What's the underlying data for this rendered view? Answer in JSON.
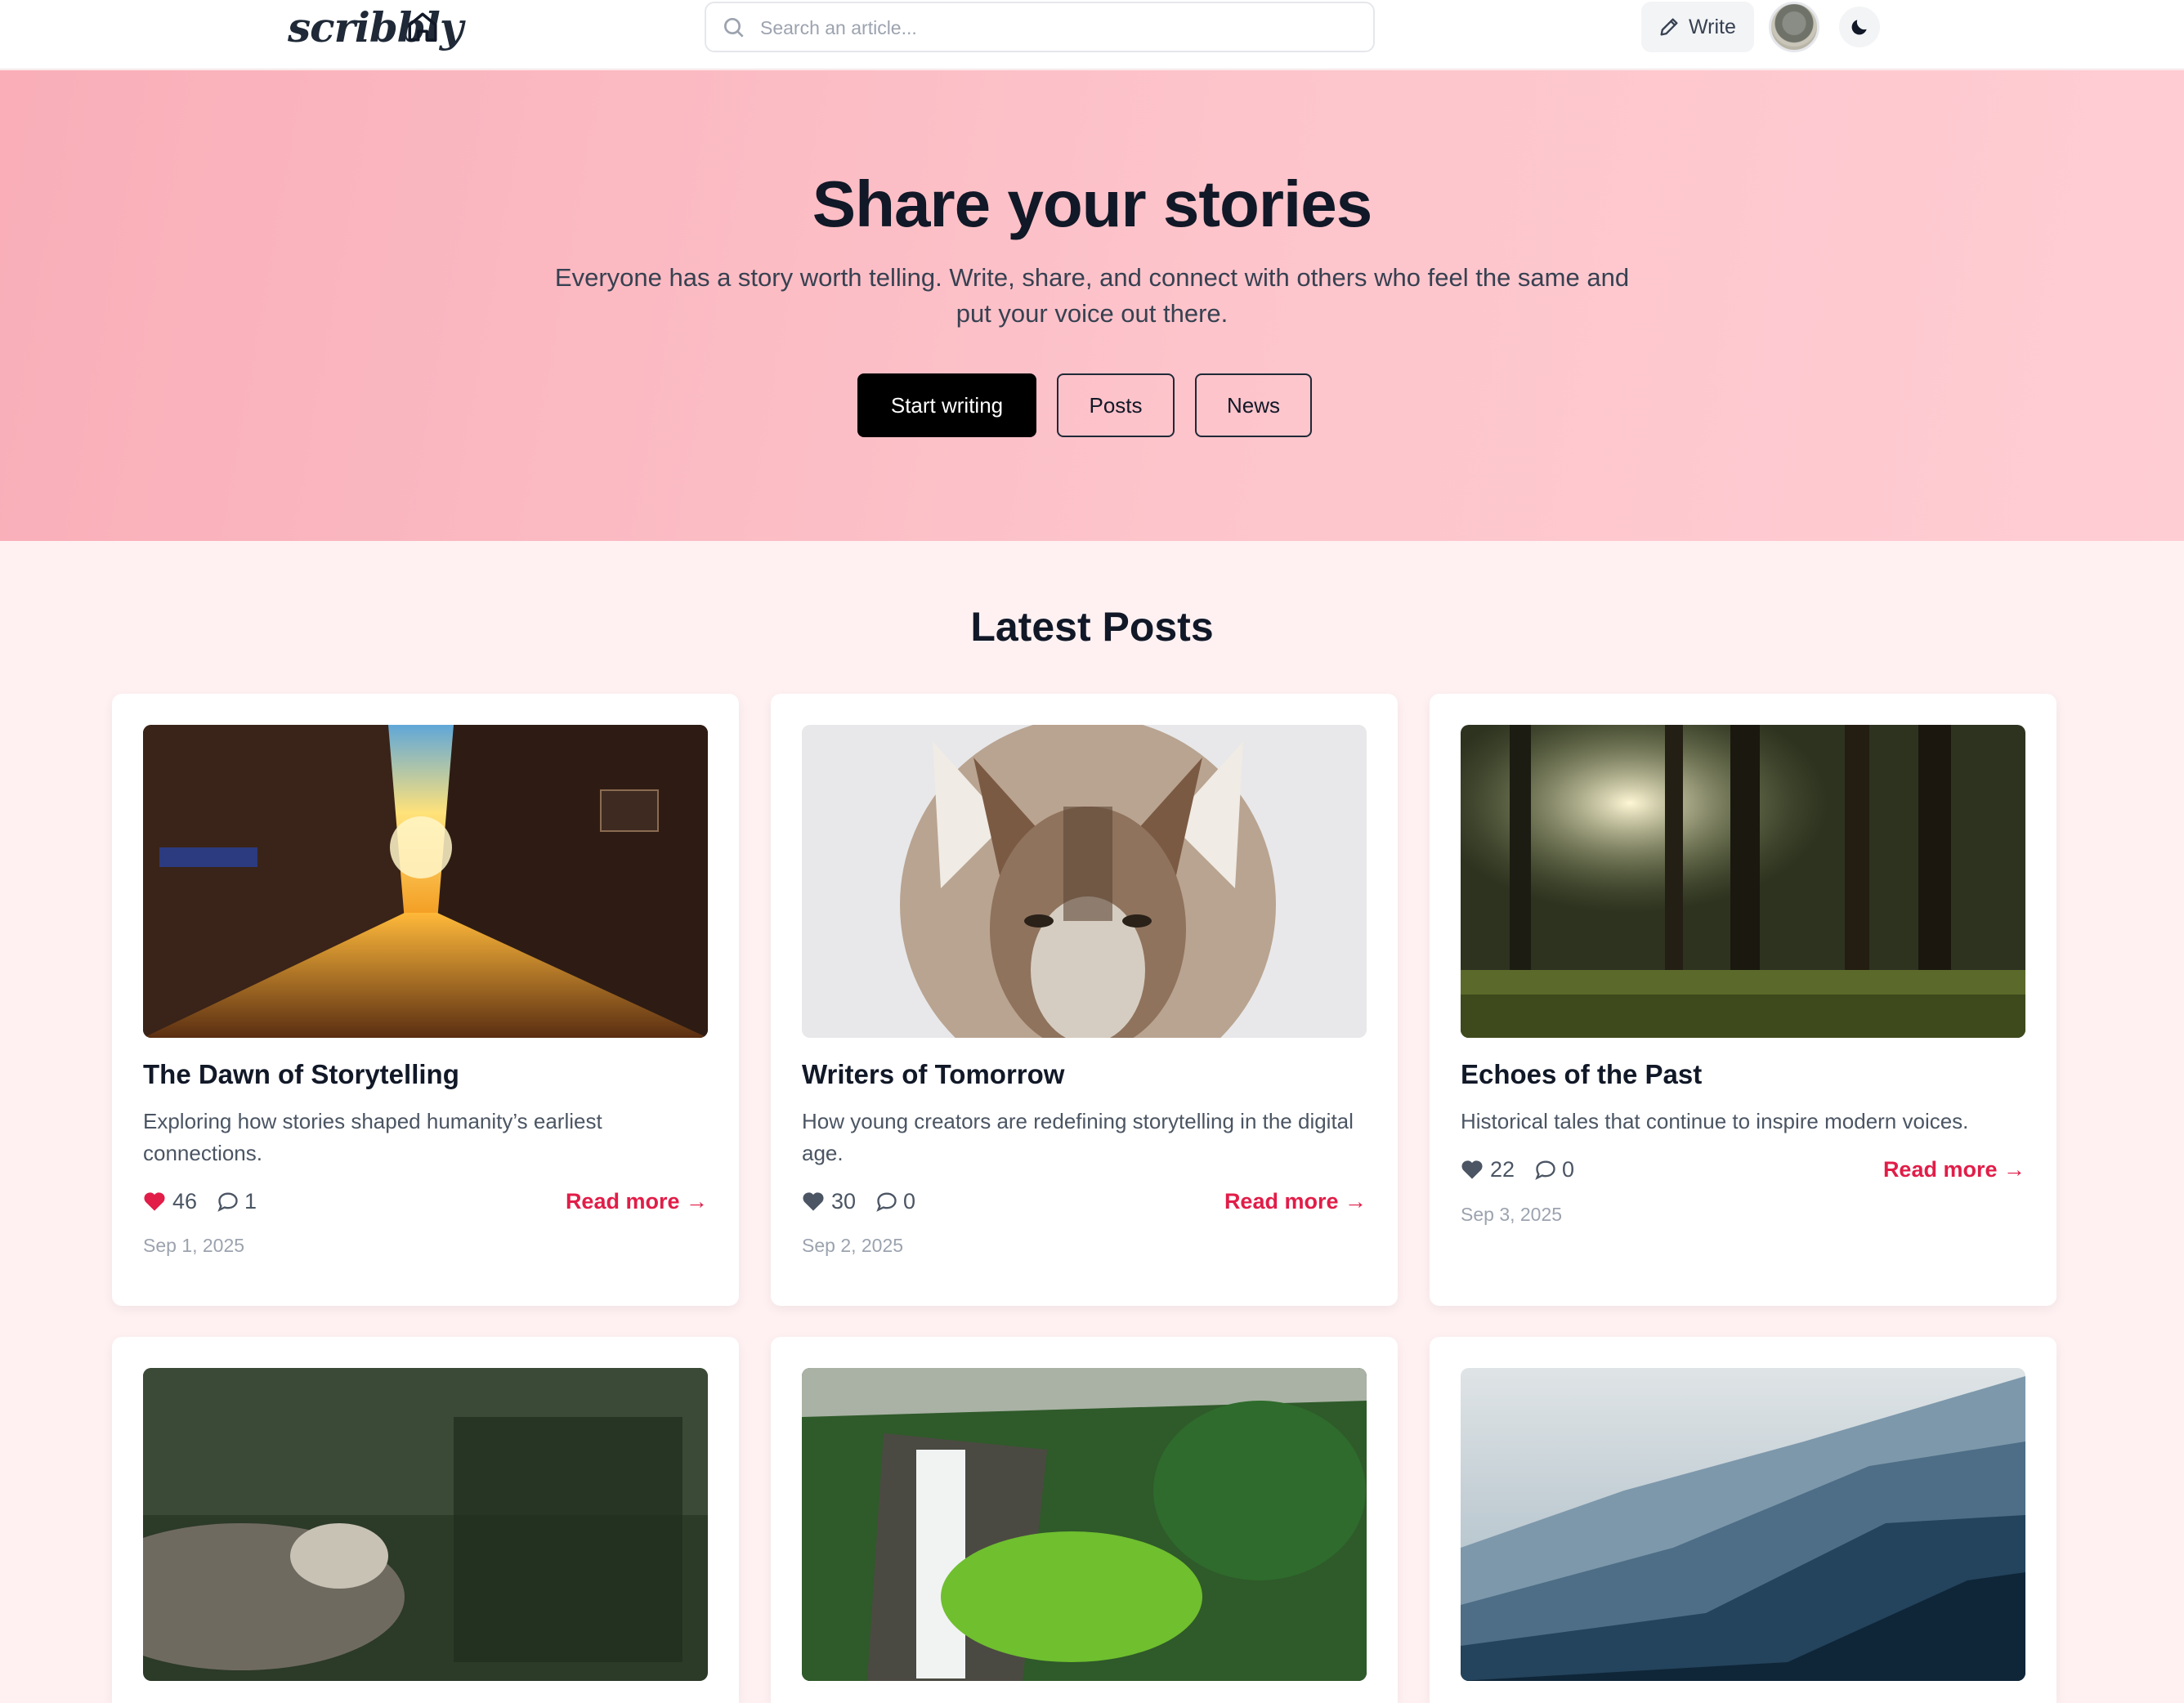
{
  "header": {
    "logo": "scribbly",
    "search_placeholder": "Search an article...",
    "write_label": "Write"
  },
  "hero": {
    "title": "Share your stories",
    "subtitle": "Everyone has a story worth telling. Write, share, and connect with others who feel the same and put your voice out there.",
    "buttons": {
      "start": "Start writing",
      "posts": "Posts",
      "news": "News"
    }
  },
  "latest": {
    "title": "Latest Posts",
    "cards": [
      {
        "title": "The Dawn of Storytelling",
        "description": "Exploring how stories shaped humanity’s earliest connections.",
        "likes": "46",
        "comments": "1",
        "read_more": "Read more →",
        "date": "Sep 1, 2025"
      },
      {
        "title": "Writers of Tomorrow",
        "description": "How young creators are redefining storytelling in the digital age.",
        "likes": "30",
        "comments": "0",
        "read_more": "Read more →",
        "date": "Sep 2, 2025"
      },
      {
        "title": "Echoes of the Past",
        "description": "Historical tales that continue to inspire modern voices.",
        "likes": "22",
        "comments": "0",
        "read_more": "Read more →",
        "date": "Sep 3, 2025"
      }
    ]
  },
  "colors": {
    "accent": "#e11d48",
    "hero_start": "#f9aeb8",
    "hero_end": "#fecdd3",
    "page_bg": "#fff1f2"
  },
  "icons": [
    "home-icon",
    "search-icon",
    "pencil-icon",
    "moon-icon",
    "heart-icon",
    "comment-icon"
  ]
}
